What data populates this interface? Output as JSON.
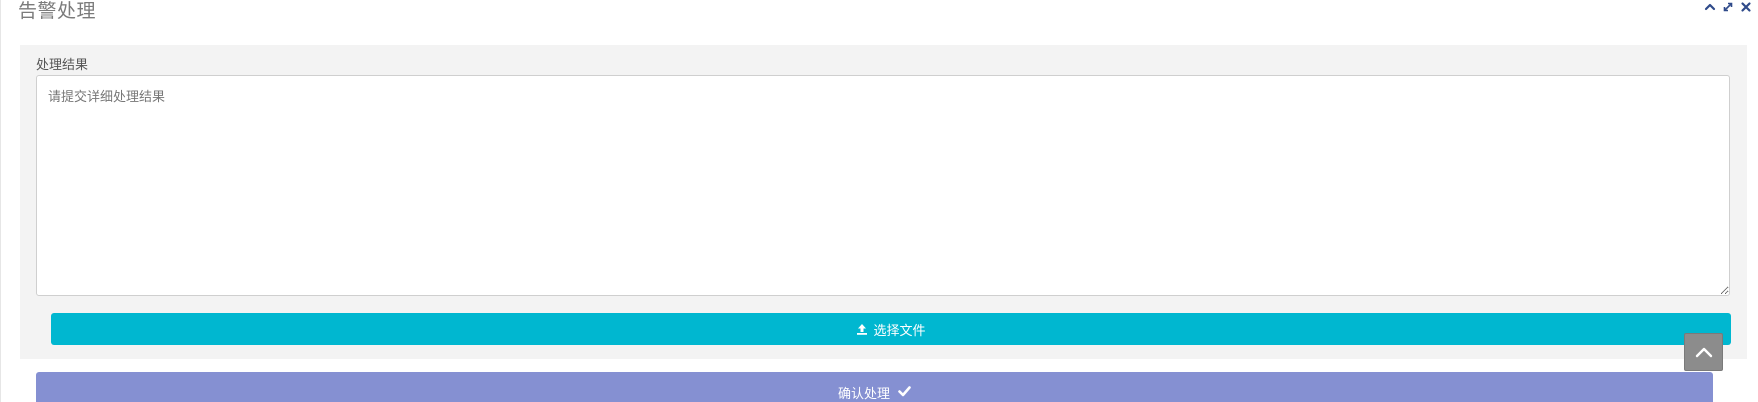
{
  "panel": {
    "title": "告警处理",
    "tools": {
      "collapse_icon": "chevron-up-icon",
      "expand_icon": "expand-arrows-icon",
      "close_icon": "close-icon"
    }
  },
  "form": {
    "result_label": "处理结果",
    "result_placeholder": "请提交详细处理结果",
    "result_value": "",
    "upload_button_label": "选择文件",
    "upload_icon": "upload-icon"
  },
  "actions": {
    "confirm_label": "确认处理",
    "confirm_icon": "check-icon"
  },
  "scroll_top": {
    "icon": "chevron-up-icon"
  },
  "colors": {
    "upload_button": "#00b7d0",
    "confirm_button": "#8590d2",
    "panel_background": "#f3f3f3",
    "tool_icons": "#2f4a8a"
  }
}
